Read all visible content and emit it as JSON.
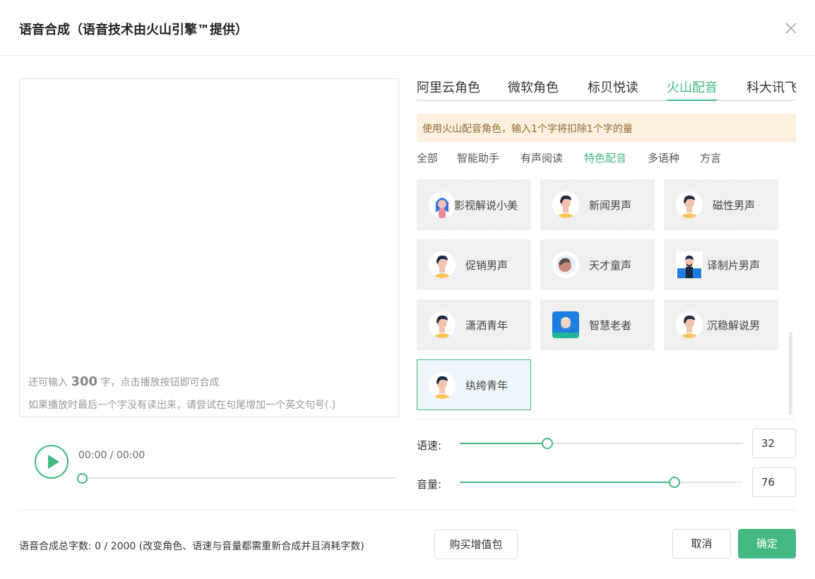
{
  "dialog": {
    "title": "语音合成（语音技术由火山引擎™提供）"
  },
  "editor": {
    "hint_prefix": "还可输入",
    "remaining": "300",
    "hint_suffix": "字，点击播放按钮即可合成",
    "hint_line2": "如果播放时最后一个字没有读出来，请尝试在句尾增加一个英文句号(.)"
  },
  "player": {
    "time": "00:00 / 00:00",
    "progress": 0
  },
  "tabs": [
    {
      "label": "阿里云角色",
      "active": false
    },
    {
      "label": "微软角色",
      "active": false
    },
    {
      "label": "标贝悦读",
      "active": false
    },
    {
      "label": "火山配音",
      "active": true
    },
    {
      "label": "科大讯飞",
      "active": false
    }
  ],
  "notice": "使用火山配音角色，输入1个字将扣除1个字的量",
  "filters": [
    {
      "label": "全部",
      "active": false
    },
    {
      "label": "智能助手",
      "active": false
    },
    {
      "label": "有声阅读",
      "active": false
    },
    {
      "label": "特色配音",
      "active": true
    },
    {
      "label": "多语种",
      "active": false
    },
    {
      "label": "方言",
      "active": false
    }
  ],
  "voices": [
    {
      "name": "影视解说小美",
      "avatar": "female-avatar-icon",
      "selected": false
    },
    {
      "name": "新闻男声",
      "avatar": "male-avatar-icon",
      "selected": false
    },
    {
      "name": "磁性男声",
      "avatar": "male-avatar-icon",
      "selected": false
    },
    {
      "name": "促销男声",
      "avatar": "male-avatar-icon",
      "selected": false
    },
    {
      "name": "天才童声",
      "avatar": "child-avatar-icon",
      "selected": false
    },
    {
      "name": "译制片男声",
      "avatar": "dubbing-male-avatar-icon",
      "selected": false
    },
    {
      "name": "潇洒青年",
      "avatar": "male-avatar-icon",
      "selected": false
    },
    {
      "name": "智慧老者",
      "avatar": "elder-avatar-icon",
      "selected": false
    },
    {
      "name": "沉稳解说男",
      "avatar": "male-avatar-icon",
      "selected": false
    },
    {
      "name": "纨绔青年",
      "avatar": "male-avatar-icon",
      "selected": true
    }
  ],
  "speed": {
    "label": "语速:",
    "value": "32",
    "level": 0.31
  },
  "volume": {
    "label": "音量:",
    "value": "76",
    "level": 0.757
  },
  "footer": {
    "count_text": "语音合成总字数:  0 / 2000  (改变角色、语速与音量都需重新合成并且消耗字数)",
    "buy_label": "购买增值包",
    "cancel_label": "取消",
    "ok_label": "确定"
  },
  "colors": {
    "accent": "#43b883",
    "notice_bg": "#fdf0de"
  }
}
